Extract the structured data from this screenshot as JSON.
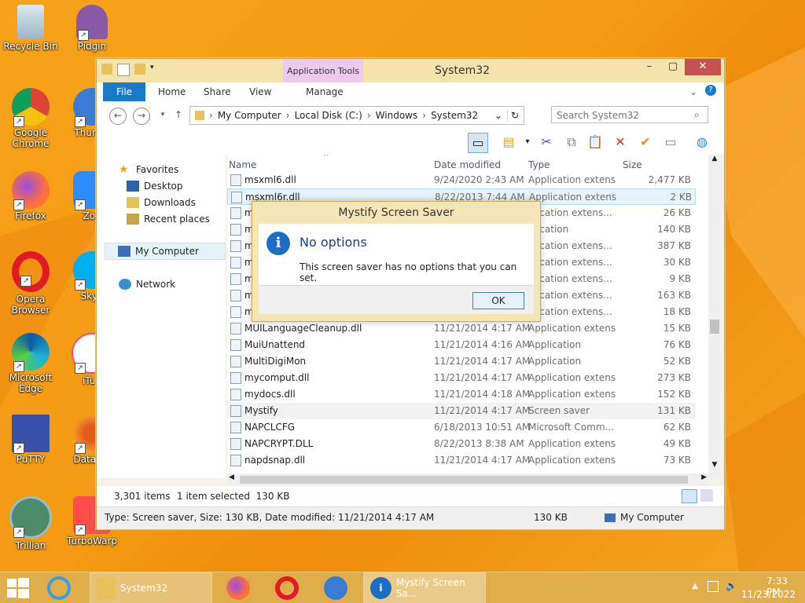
{
  "desktop": {
    "icons": [
      {
        "label": "Recycle Bin",
        "icon": "recycle-bin-icon"
      },
      {
        "label": "Pidgin",
        "icon": "pidgin-icon"
      },
      {
        "label": "Google Chrome",
        "icon": "chrome-icon"
      },
      {
        "label": "Thunde",
        "icon": "thunderbird-icon"
      },
      {
        "label": "Firefox",
        "icon": "firefox-icon"
      },
      {
        "label": "Zoo",
        "icon": "zoom-icon"
      },
      {
        "label": "Opera Browser",
        "icon": "opera-icon"
      },
      {
        "label": "Skyp",
        "icon": "skype-icon"
      },
      {
        "label": "Microsoft Edge",
        "icon": "edge-icon"
      },
      {
        "label": "iTun",
        "icon": "itunes-icon"
      },
      {
        "label": "PuTTY",
        "icon": "putty-icon"
      },
      {
        "label": "DataWa",
        "icon": "datawarrior-icon"
      },
      {
        "label": "Trillian",
        "icon": "trillian-icon"
      },
      {
        "label": "TurboWarp",
        "icon": "turbowarp-icon"
      }
    ]
  },
  "window": {
    "title": "System32",
    "context_tab": "Application Tools",
    "tabs": {
      "file": "File",
      "home": "Home",
      "share": "Share",
      "view": "View",
      "manage": "Manage"
    },
    "breadcrumb": [
      "My Computer",
      "Local Disk (C:)",
      "Windows",
      "System32"
    ],
    "search_placeholder": "Search System32",
    "nav": {
      "favorites": "Favorites",
      "desktop": "Desktop",
      "downloads": "Downloads",
      "recent": "Recent places",
      "my_computer": "My Computer",
      "network": "Network"
    },
    "columns": {
      "name": "Name",
      "date": "Date modified",
      "type": "Type",
      "size": "Size"
    },
    "files": [
      {
        "name": "msxml6.dll",
        "date": "9/24/2020 2:43 AM",
        "type": "Application extens...",
        "size": "2,477 KB"
      },
      {
        "name": "msxml6r.dll",
        "date": "8/22/2013 7:44 AM",
        "type": "Application extens...",
        "size": "2 KB"
      },
      {
        "name": "m",
        "date": "",
        "type": "plication extens...",
        "size": "26 KB"
      },
      {
        "name": "m",
        "date": "",
        "type": "plication",
        "size": "140 KB"
      },
      {
        "name": "m",
        "date": "",
        "type": "plication extens...",
        "size": "387 KB"
      },
      {
        "name": "m",
        "date": "",
        "type": "plication extens...",
        "size": "30 KB"
      },
      {
        "name": "m",
        "date": "",
        "type": "plication extens...",
        "size": "9 KB"
      },
      {
        "name": "m",
        "date": "",
        "type": "plication extens...",
        "size": "163 KB"
      },
      {
        "name": "m",
        "date": "",
        "type": "plication extens...",
        "size": "18 KB"
      },
      {
        "name": "MUILanguageCleanup.dll",
        "date": "11/21/2014 4:17 AM",
        "type": "Application extens...",
        "size": "15 KB"
      },
      {
        "name": "MuiUnattend",
        "date": "11/21/2014 4:16 AM",
        "type": "Application",
        "size": "76 KB"
      },
      {
        "name": "MultiDigiMon",
        "date": "11/21/2014 4:17 AM",
        "type": "Application",
        "size": "52 KB"
      },
      {
        "name": "mycomput.dll",
        "date": "11/21/2014 4:17 AM",
        "type": "Application extens...",
        "size": "273 KB"
      },
      {
        "name": "mydocs.dll",
        "date": "11/21/2014 4:18 AM",
        "type": "Application extens...",
        "size": "152 KB"
      },
      {
        "name": "Mystify",
        "date": "11/21/2014 4:17 AM",
        "type": "Screen saver",
        "size": "131 KB"
      },
      {
        "name": "NAPCLCFG",
        "date": "6/18/2013 10:51 AM",
        "type": "Microsoft Comm...",
        "size": "62 KB"
      },
      {
        "name": "NAPCRYPT.DLL",
        "date": "8/22/2013 8:38 AM",
        "type": "Application extens...",
        "size": "49 KB"
      },
      {
        "name": "napdsnap.dll",
        "date": "11/21/2014 4:17 AM",
        "type": "Application extens...",
        "size": "73 KB"
      }
    ],
    "status": {
      "count": "3,301 items",
      "selected": "1 item selected  130 KB"
    },
    "details": {
      "text": "Type: Screen saver, Size: 130 KB, Date modified: 11/21/2014 4:17 AM",
      "size": "130 KB",
      "location": "My Computer"
    }
  },
  "dialog": {
    "title": "Mystify Screen Saver",
    "heading": "No options",
    "message": "This screen saver has no options that you can set.",
    "ok": "OK"
  },
  "taskbar": {
    "items": [
      {
        "label": "System32"
      },
      {
        "label": "Mystify Screen Sa..."
      }
    ],
    "time": "7:33 PM",
    "date": "11/23/2022"
  },
  "colors": {
    "accent": "#1979ca",
    "taskbar": "#dfae4a",
    "window_frame": "#f4e3ad"
  }
}
